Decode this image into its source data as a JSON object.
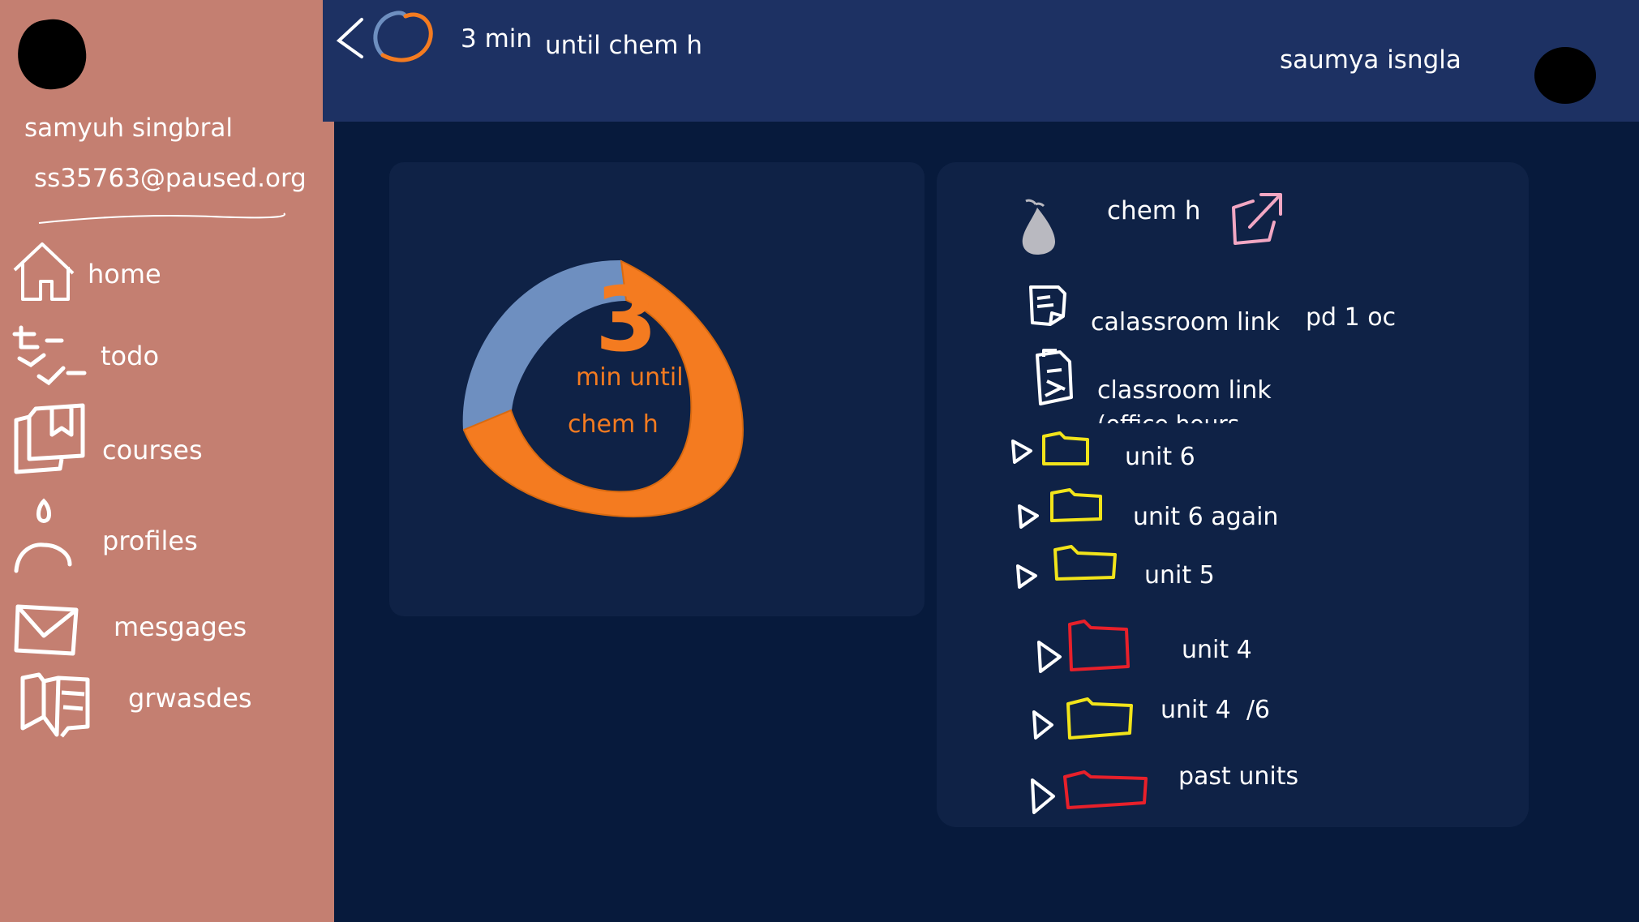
{
  "header": {
    "countdown_value": "3 min",
    "countdown_label": "until chem h",
    "user_name": "saumya isngla"
  },
  "sidebar": {
    "name": "samyuh singbral",
    "email": "ss35763@paused.org",
    "items": [
      {
        "label": "home",
        "icon": "home-icon"
      },
      {
        "label": "todo",
        "icon": "checklist-icon"
      },
      {
        "label": "courses",
        "icon": "book-icon"
      },
      {
        "label": "profiles",
        "icon": "person-icon"
      },
      {
        "label": "mesgages",
        "icon": "envelope-icon"
      },
      {
        "label": "grwasdes",
        "icon": "open-book-icon"
      }
    ]
  },
  "timer": {
    "number": "3",
    "line1": "min until",
    "line2": "chem h",
    "remaining_fraction": 0.75
  },
  "course": {
    "title": "chem h",
    "links": [
      {
        "label": "calassroom link",
        "note": "pd 1 oc"
      },
      {
        "label": "classroom link",
        "sub": "(office hours"
      }
    ],
    "folders": [
      {
        "label": "unit 6",
        "color": "#f2e41a"
      },
      {
        "label": "unit 6 again",
        "color": "#f2e41a"
      },
      {
        "label": "unit 5",
        "color": "#f2e41a"
      },
      {
        "label": "unit 4",
        "color": "#f2e41a"
      },
      {
        "label": "unit 4  /6",
        "color": "#f2e41a"
      },
      {
        "label": "past units",
        "color": "#e8202a"
      }
    ]
  },
  "colors": {
    "sidebar": "#c47f71",
    "header": "#1d3163",
    "background": "#071a3c",
    "panel": "#0f2246",
    "accent_orange": "#f47b20",
    "accent_blue": "#6e8fc0"
  }
}
